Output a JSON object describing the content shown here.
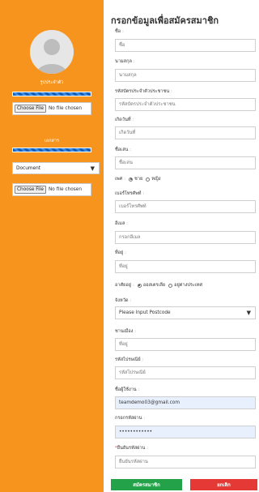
{
  "sidebar": {
    "avatar_label": "รูปประจำตัว",
    "photo_file": {
      "button": "Choose File",
      "status": "No file chosen"
    },
    "documents_label": "เอกสาร",
    "document_type": "Document",
    "document_file": {
      "button": "Choose File",
      "status": "No file chosen"
    }
  },
  "form": {
    "title": "กรอกข้อมูลเพื่อสมัครสมาชิก",
    "first_name": {
      "label": "ชื่อ",
      "placeholder": "ชื่อ"
    },
    "last_name": {
      "label": "นามสกุล",
      "placeholder": "นามสกุล"
    },
    "id_card": {
      "label": "รหัสบัตรประจำตัวประชาชน",
      "placeholder": "รหัสบัตรประจำตัวประชาชน"
    },
    "birthdate": {
      "label": "เกิดวันที่",
      "placeholder": "เกิดวันที่"
    },
    "nickname": {
      "label": "ชื่อเล่น",
      "placeholder": "ชื่อเล่น"
    },
    "gender": {
      "label": "เพศ",
      "male": "ชาย",
      "female": "หญิง"
    },
    "phone": {
      "label": "เบอร์โทรศัพท์",
      "placeholder": "เบอร์โทรศัพท์"
    },
    "email": {
      "label": "อีเมล",
      "placeholder": "กรอกอีเมล"
    },
    "address": {
      "label": "ที่อยู่",
      "placeholder": "ที่อยู่"
    },
    "residence": {
      "label": "อาศัยอยู่",
      "option_au": "ออสเตรเลีย",
      "option_abroad": "อยู่ต่างประเทศ"
    },
    "province": {
      "label": "จังหวัด",
      "value": "Please Input Postcode"
    },
    "district": {
      "label": "ชานเมือง",
      "placeholder": "ที่อยู่"
    },
    "postcode": {
      "label": "รหัสไปรษณีย์",
      "placeholder": "รหัสไปรษณีย์"
    },
    "username": {
      "label": "ชื่อผู้ใช้งาน",
      "value": "teamdemo03@gmail.com"
    },
    "password": {
      "label": "กรอกรหัสผ่าน",
      "value": "••••••••••••"
    },
    "confirm_password": {
      "label": "ยืนยันรหัสผ่าน",
      "placeholder": "ยืนยันรหัสผ่าน"
    },
    "submit_label": "สมัครสมาชิก",
    "cancel_label": "ยกเลิก"
  }
}
